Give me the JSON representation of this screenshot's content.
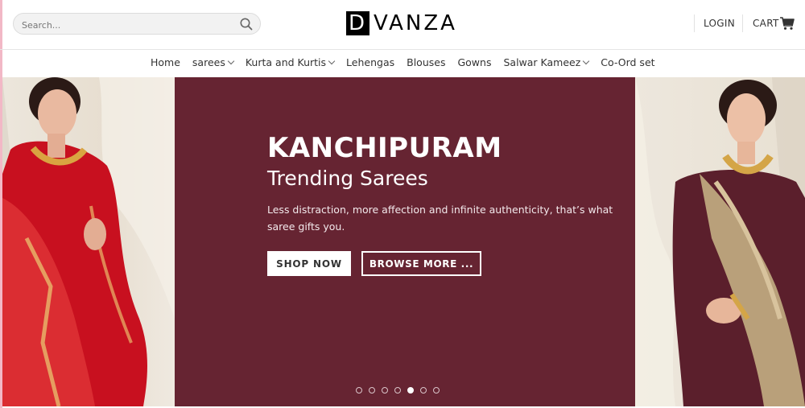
{
  "search": {
    "placeholder": "Search..."
  },
  "logo": {
    "mark": "D",
    "word": "VANZA"
  },
  "header": {
    "login": "LOGIN",
    "cart": "CART"
  },
  "nav": {
    "items": [
      {
        "label": "Home",
        "dropdown": false
      },
      {
        "label": "sarees",
        "dropdown": true
      },
      {
        "label": "Kurta and Kurtis",
        "dropdown": true
      },
      {
        "label": "Lehengas",
        "dropdown": false
      },
      {
        "label": "Blouses",
        "dropdown": false
      },
      {
        "label": "Gowns",
        "dropdown": false
      },
      {
        "label": "Salwar Kameez",
        "dropdown": true
      },
      {
        "label": "Co-Ord set",
        "dropdown": false
      }
    ]
  },
  "hero": {
    "title": "KANCHIPURAM",
    "subtitle": "Trending Sarees",
    "description": "Less distraction, more affection and infinite authenticity, that’s what saree gifts you.",
    "shop_label": "SHOP NOW",
    "browse_label": "BROWSE MORE ...",
    "background": "#662432",
    "slides": 7,
    "active_slide": 5
  }
}
